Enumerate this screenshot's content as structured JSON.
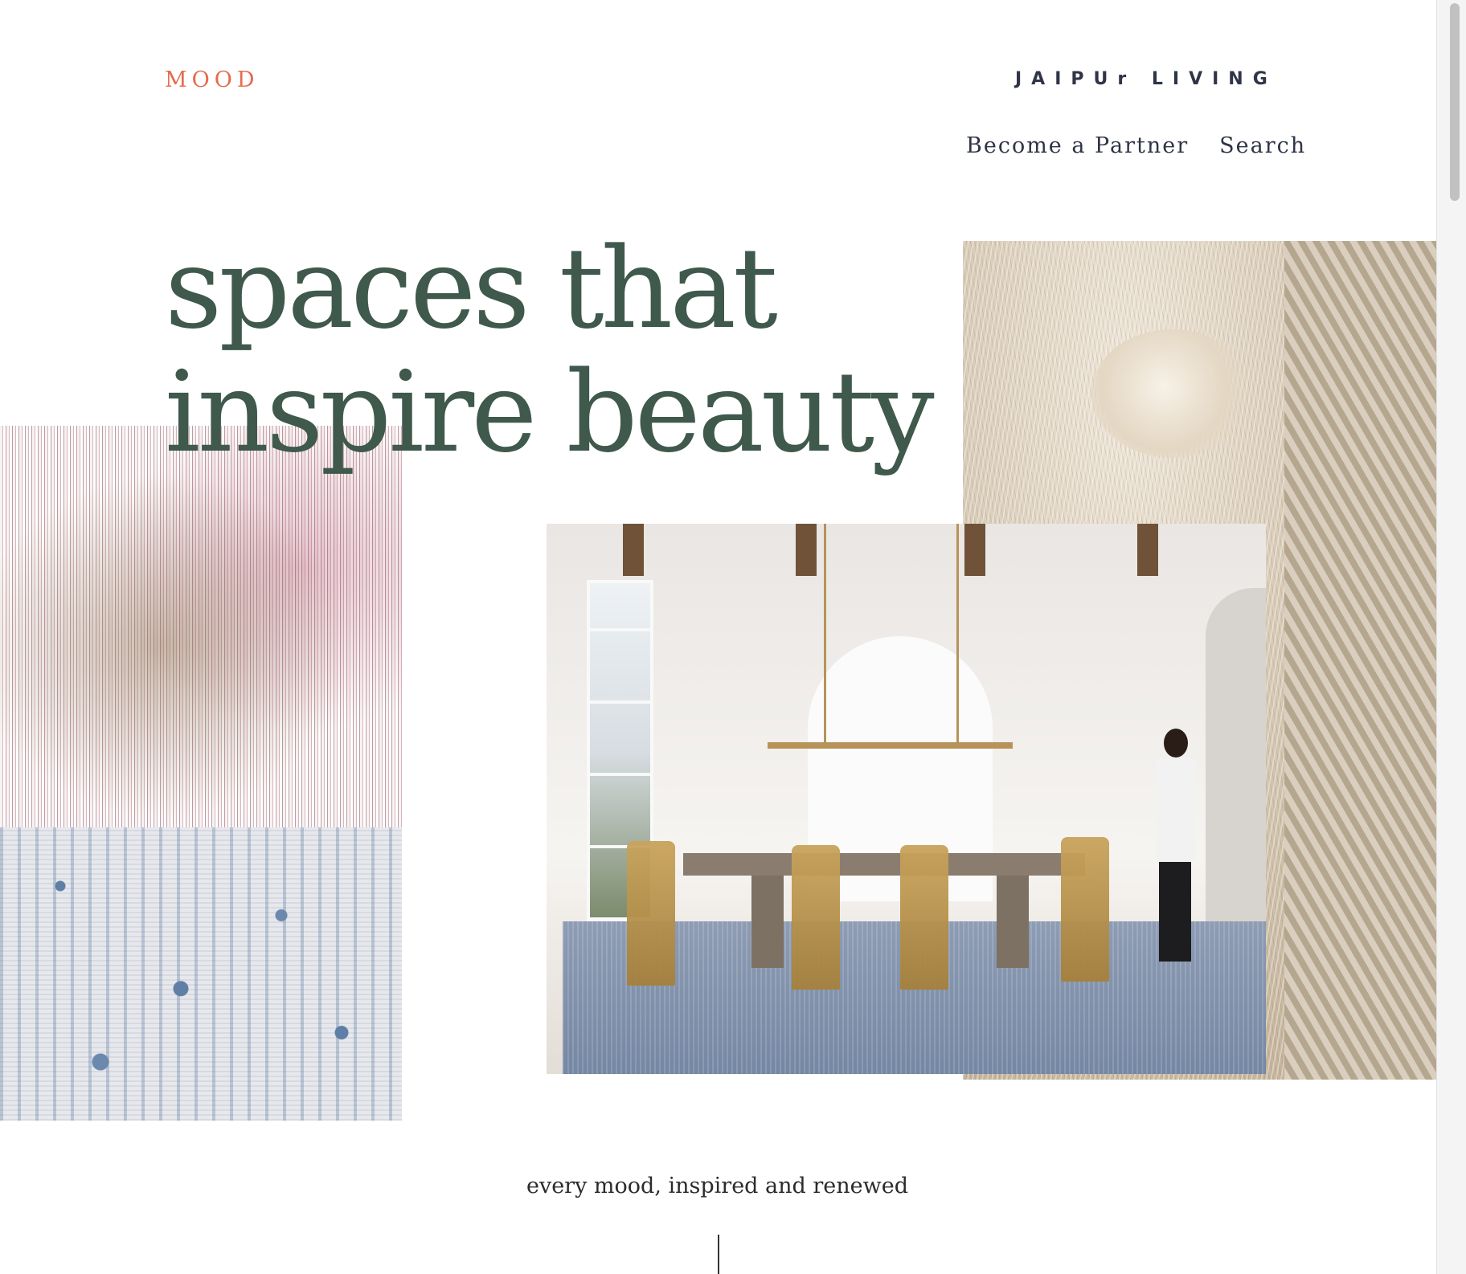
{
  "header": {
    "brand": "MOOD",
    "logo": "JAIPUr LIVING",
    "nav": [
      "Become a Partner",
      "Search"
    ]
  },
  "hero": {
    "headline_line1": "spaces that",
    "headline_line2": "inspire beauty"
  },
  "images": {
    "left": "loom-rug-photo",
    "right": "yarn-skein-photo",
    "center": "dining-room-photo"
  },
  "tagline": "every mood, inspired and renewed",
  "colors": {
    "accent": "#e56b4f",
    "headline": "#3f594c",
    "nav": "#2f3446"
  }
}
